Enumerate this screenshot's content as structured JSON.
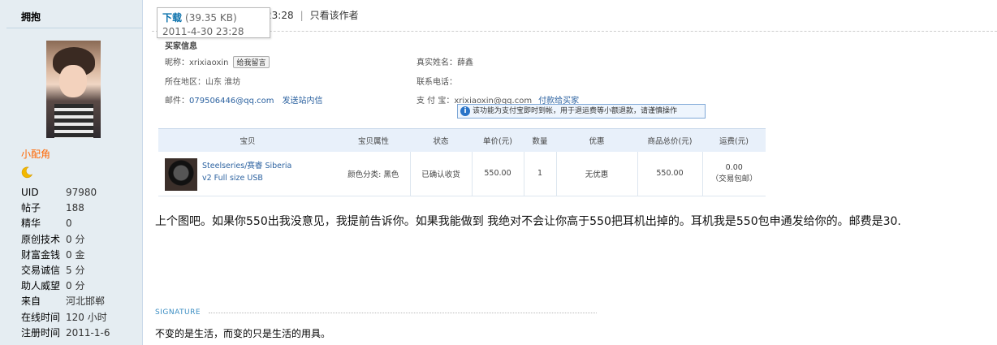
{
  "sidebar": {
    "username": "拥抱",
    "group": "小配角",
    "stats": [
      {
        "k": "UID",
        "v": "97980"
      },
      {
        "k": "帖子",
        "v": "188"
      },
      {
        "k": "精华",
        "v": "0"
      },
      {
        "k": "原创技术",
        "v": "0 分"
      },
      {
        "k": "财富金钱",
        "v": "0 金"
      },
      {
        "k": "交易诚信",
        "v": "5 分"
      },
      {
        "k": "助人威望",
        "v": "0 分"
      },
      {
        "k": "来自",
        "v": "河北邯郸"
      },
      {
        "k": "在线时间",
        "v": "120 小时"
      },
      {
        "k": "注册时间",
        "v": "2011-1-6"
      }
    ]
  },
  "post": {
    "time_partial": "23:28",
    "author_only": "只看该作者",
    "attachment": {
      "download_label": "下载",
      "size": "(39.35 KB)",
      "date": "2011-4-30 23:28"
    },
    "content": "上个图吧。如果你550出我没意见，我提前告诉你。如果我能做到 我绝对不会让你高于550把耳机出掉的。耳机我是550包申通发给你的。邮费是30.",
    "signature_label": "SIGNATURE",
    "signature": "不变的是生活，而变的只是生活的用具。"
  },
  "image": {
    "section_title": "买家信息",
    "nick_label": "昵称：",
    "nick": "xrixiaoxin",
    "msg_btn": "给我留言",
    "realname_label": "真实姓名：",
    "realname": "薛鑫",
    "region_label": "所在地区：",
    "region": "山东 淮坊",
    "phone_label": "联系电话：",
    "email_label": "邮件：",
    "email": "079506446@qq.com",
    "send_msg": "发送站内信",
    "alipay_label": "支 付 宝：",
    "alipay": "xrixiaoxin@qq.com",
    "pay_link": "付款给买家",
    "tip": "该功能为支付宝即时到帐，用于退运费等小额退款，请谨慎操作",
    "table": {
      "headers": [
        "宝贝",
        "宝贝属性",
        "状态",
        "单价(元)",
        "数量",
        "优惠",
        "商品总价(元)",
        "运费(元)"
      ],
      "row": {
        "name": "Steelseries/赛睿 Siberia v2 Full size USB",
        "attr": "颜色分类: 黑色",
        "status": "已确认收货",
        "price": "550.00",
        "qty": "1",
        "discount": "无优惠",
        "total": "550.00",
        "shipping": "0.00",
        "shipping_note": "（交易包邮）"
      }
    }
  }
}
